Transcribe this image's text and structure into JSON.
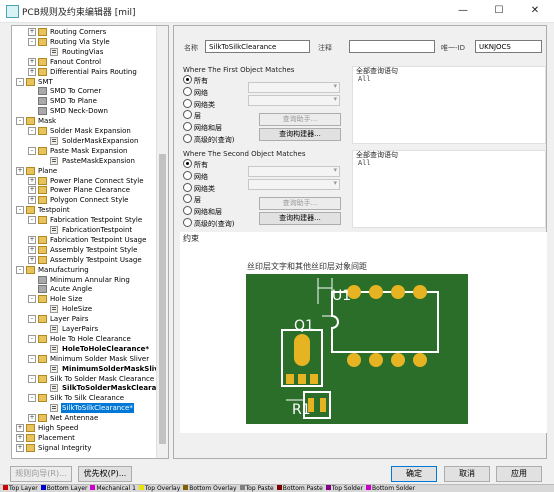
{
  "window": {
    "title": "PCB规则及约束编辑器 [mil]"
  },
  "tree": {
    "items": [
      {
        "label": "Routing Corners",
        "level": 1,
        "kind": "folder",
        "exp": "+"
      },
      {
        "label": "Routing Via Style",
        "level": 1,
        "kind": "folder",
        "exp": "-"
      },
      {
        "label": "RoutingVias",
        "level": 2,
        "kind": "rule"
      },
      {
        "label": "Fanout Control",
        "level": 1,
        "kind": "folder",
        "exp": "+"
      },
      {
        "label": "Differential Pairs Routing",
        "level": 1,
        "kind": "folder",
        "exp": "+"
      },
      {
        "label": "SMT",
        "level": 0,
        "kind": "folder",
        "exp": "-"
      },
      {
        "label": "SMD To Corner",
        "level": 1,
        "kind": "sub"
      },
      {
        "label": "SMD To Plane",
        "level": 1,
        "kind": "sub"
      },
      {
        "label": "SMD Neck-Down",
        "level": 1,
        "kind": "sub"
      },
      {
        "label": "Mask",
        "level": 0,
        "kind": "folder",
        "exp": "-"
      },
      {
        "label": "Solder Mask Expansion",
        "level": 1,
        "kind": "folder",
        "exp": "-"
      },
      {
        "label": "SolderMaskExpansion",
        "level": 2,
        "kind": "rule"
      },
      {
        "label": "Paste Mask Expansion",
        "level": 1,
        "kind": "folder",
        "exp": "-"
      },
      {
        "label": "PasteMaskExpansion",
        "level": 2,
        "kind": "rule"
      },
      {
        "label": "Plane",
        "level": 0,
        "kind": "folder",
        "exp": "+"
      },
      {
        "label": "Power Plane Connect Style",
        "level": 1,
        "kind": "folder",
        "exp": "+"
      },
      {
        "label": "Power Plane Clearance",
        "level": 1,
        "kind": "folder",
        "exp": "+"
      },
      {
        "label": "Polygon Connect Style",
        "level": 1,
        "kind": "folder",
        "exp": "+"
      },
      {
        "label": "Testpoint",
        "level": 0,
        "kind": "folder",
        "exp": "-"
      },
      {
        "label": "Fabrication Testpoint Style",
        "level": 1,
        "kind": "folder",
        "exp": "-"
      },
      {
        "label": "FabricationTestpoint",
        "level": 2,
        "kind": "rule"
      },
      {
        "label": "Fabrication Testpoint Usage",
        "level": 1,
        "kind": "folder",
        "exp": "+"
      },
      {
        "label": "Assembly Testpoint Style",
        "level": 1,
        "kind": "folder",
        "exp": "+"
      },
      {
        "label": "Assembly Testpoint Usage",
        "level": 1,
        "kind": "folder",
        "exp": "+"
      },
      {
        "label": "Manufacturing",
        "level": 0,
        "kind": "folder",
        "exp": "-"
      },
      {
        "label": "Minimum Annular Ring",
        "level": 1,
        "kind": "sub"
      },
      {
        "label": "Acute Angle",
        "level": 1,
        "kind": "sub"
      },
      {
        "label": "Hole Size",
        "level": 1,
        "kind": "folder",
        "exp": "-"
      },
      {
        "label": "HoleSize",
        "level": 2,
        "kind": "rule"
      },
      {
        "label": "Layer Pairs",
        "level": 1,
        "kind": "folder",
        "exp": "-"
      },
      {
        "label": "LayerPairs",
        "level": 2,
        "kind": "rule"
      },
      {
        "label": "Hole To Hole Clearance",
        "level": 1,
        "kind": "folder",
        "exp": "-"
      },
      {
        "label": "HoleToHoleClearance*",
        "level": 2,
        "kind": "rule",
        "bold": true
      },
      {
        "label": "Minimum Solder Mask Sliver",
        "level": 1,
        "kind": "folder",
        "exp": "-"
      },
      {
        "label": "MinimumSolderMaskSliver*",
        "level": 2,
        "kind": "rule",
        "bold": true
      },
      {
        "label": "Silk To Solder Mask Clearance",
        "level": 1,
        "kind": "folder",
        "exp": "-"
      },
      {
        "label": "SilkToSolderMaskClearance*",
        "level": 2,
        "kind": "rule",
        "bold": true
      },
      {
        "label": "Silk To Silk Clearance",
        "level": 1,
        "kind": "folder",
        "exp": "-"
      },
      {
        "label": "SilkToSilkClearance*",
        "level": 2,
        "kind": "rule",
        "selected": true
      },
      {
        "label": "Net Antennae",
        "level": 1,
        "kind": "folder",
        "exp": "+"
      },
      {
        "label": "High Speed",
        "level": 0,
        "kind": "folder",
        "exp": "+"
      },
      {
        "label": "Placement",
        "level": 0,
        "kind": "folder",
        "exp": "+"
      },
      {
        "label": "Signal Integrity",
        "level": 0,
        "kind": "folder",
        "exp": "+"
      }
    ]
  },
  "rule": {
    "name_label": "名称",
    "name_value": "SilkToSilkClearance",
    "comment_label": "注释",
    "comment_value": "",
    "uid_label": "唯一-ID",
    "uid_value": "UKNJOCS"
  },
  "first": {
    "title": "Where The First Object Matches",
    "options": [
      "所有",
      "网络",
      "网络类",
      "层",
      "网络和层",
      "高级的(查询)"
    ],
    "selected": 0,
    "helper_btn": "查询助手...",
    "builder_btn": "查询构建器...",
    "query_title": "全部查询语句",
    "query_text": "All"
  },
  "second": {
    "title": "Where The Second Object Matches",
    "options": [
      "所有",
      "网络",
      "网络类",
      "层",
      "网络和层",
      "高级的(查询)"
    ],
    "selected": 0,
    "helper_btn": "查询助手...",
    "builder_btn": "查询构建器...",
    "query_title": "全部查询语句",
    "query_text": "All"
  },
  "constraint": {
    "title": "约束",
    "caption": "丝印层文字和其他丝印层对象间距",
    "labels": {
      "u1": "U1",
      "q1": "Q1",
      "r1": "R1"
    },
    "colors": {
      "board": "#2a6e2a",
      "silk": "#ffffff",
      "pad": "#e6b422"
    }
  },
  "footer": {
    "rule_wizard": "规则向导(R)...",
    "priorities": "优先权(P)...",
    "ok": "确定",
    "cancel": "取消",
    "apply": "应用"
  },
  "layers": [
    {
      "name": "Top Layer",
      "color": "#cc0000"
    },
    {
      "name": "Bottom Layer",
      "color": "#0000cc"
    },
    {
      "name": "Mechanical 1",
      "color": "#cc00cc"
    },
    {
      "name": "Top Overlay",
      "color": "#e6e600"
    },
    {
      "name": "Bottom Overlay",
      "color": "#806000"
    },
    {
      "name": "Top Paste",
      "color": "#808080"
    },
    {
      "name": "Bottom Paste",
      "color": "#800000"
    },
    {
      "name": "Top Solder",
      "color": "#800080"
    },
    {
      "name": "Bottom Solder",
      "color": "#cc00cc"
    }
  ]
}
